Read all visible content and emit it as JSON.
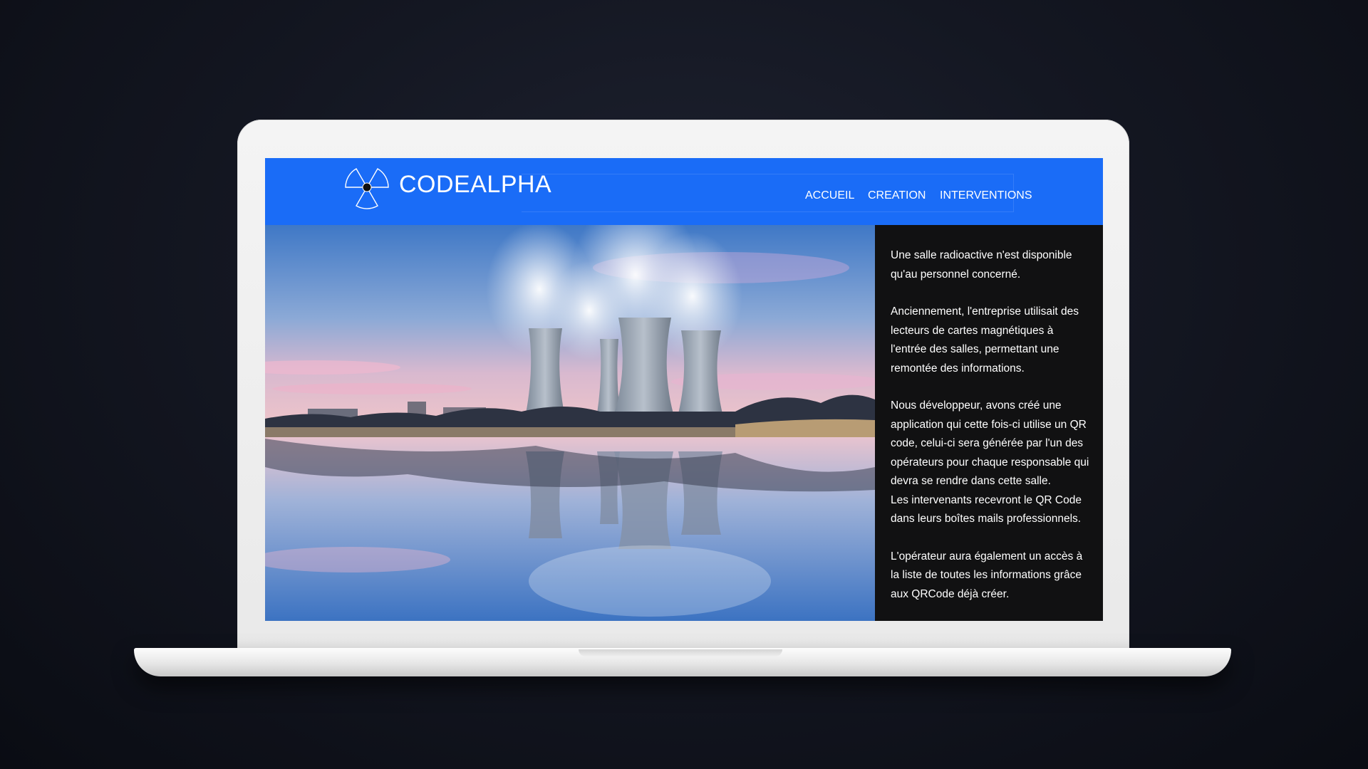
{
  "header": {
    "brand": "CODEALPHA",
    "logo_icon": "radiation-icon",
    "brand_color": "#1a6cf7"
  },
  "nav": {
    "items": [
      {
        "label": "ACCUEIL"
      },
      {
        "label": "CREATION"
      },
      {
        "label": "INTERVENTIONS"
      }
    ]
  },
  "hero": {
    "image": "nuclear-cooling-towers-lake-reflection"
  },
  "sidebar": {
    "paragraphs": [
      "Une salle radioactive n'est disponible qu'au personnel concerné.",
      "Anciennement, l'entreprise utilisait des lecteurs de cartes magnétiques à l'entrée des salles, permettant une remontée des informations.",
      "Nous développeur, avons créé une application qui cette fois-ci utilise un QR code, celui-ci sera générée par l'un des opérateurs pour chaque responsable qui devra se rendre dans cette salle.",
      "Les intervenants recevront le QR Code dans leurs boîtes mails professionnels.",
      "L'opérateur aura également un accès à la liste de toutes les informations grâce aux QRCode déjà créer."
    ]
  }
}
